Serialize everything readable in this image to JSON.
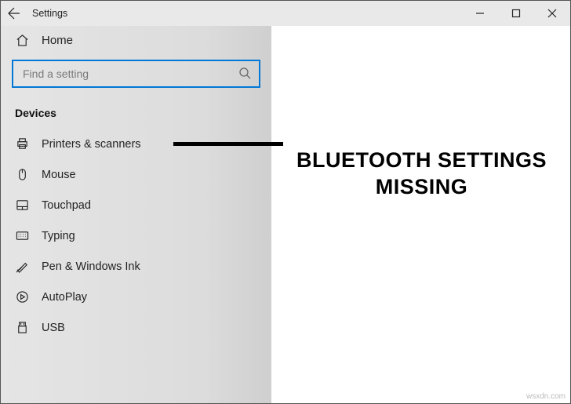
{
  "titlebar": {
    "title": "Settings"
  },
  "sidebar": {
    "home_label": "Home",
    "search_placeholder": "Find a setting",
    "category_header": "Devices",
    "items": [
      {
        "icon": "printer-icon",
        "label": "Printers & scanners"
      },
      {
        "icon": "mouse-icon",
        "label": "Mouse"
      },
      {
        "icon": "touchpad-icon",
        "label": "Touchpad"
      },
      {
        "icon": "keyboard-icon",
        "label": "Typing"
      },
      {
        "icon": "pen-icon",
        "label": "Pen & Windows Ink"
      },
      {
        "icon": "autoplay-icon",
        "label": "AutoPlay"
      },
      {
        "icon": "usb-icon",
        "label": "USB"
      }
    ]
  },
  "annotation": {
    "text": "BLUETOOTH SETTINGS MISSING"
  },
  "watermark": "wsxdn.com"
}
